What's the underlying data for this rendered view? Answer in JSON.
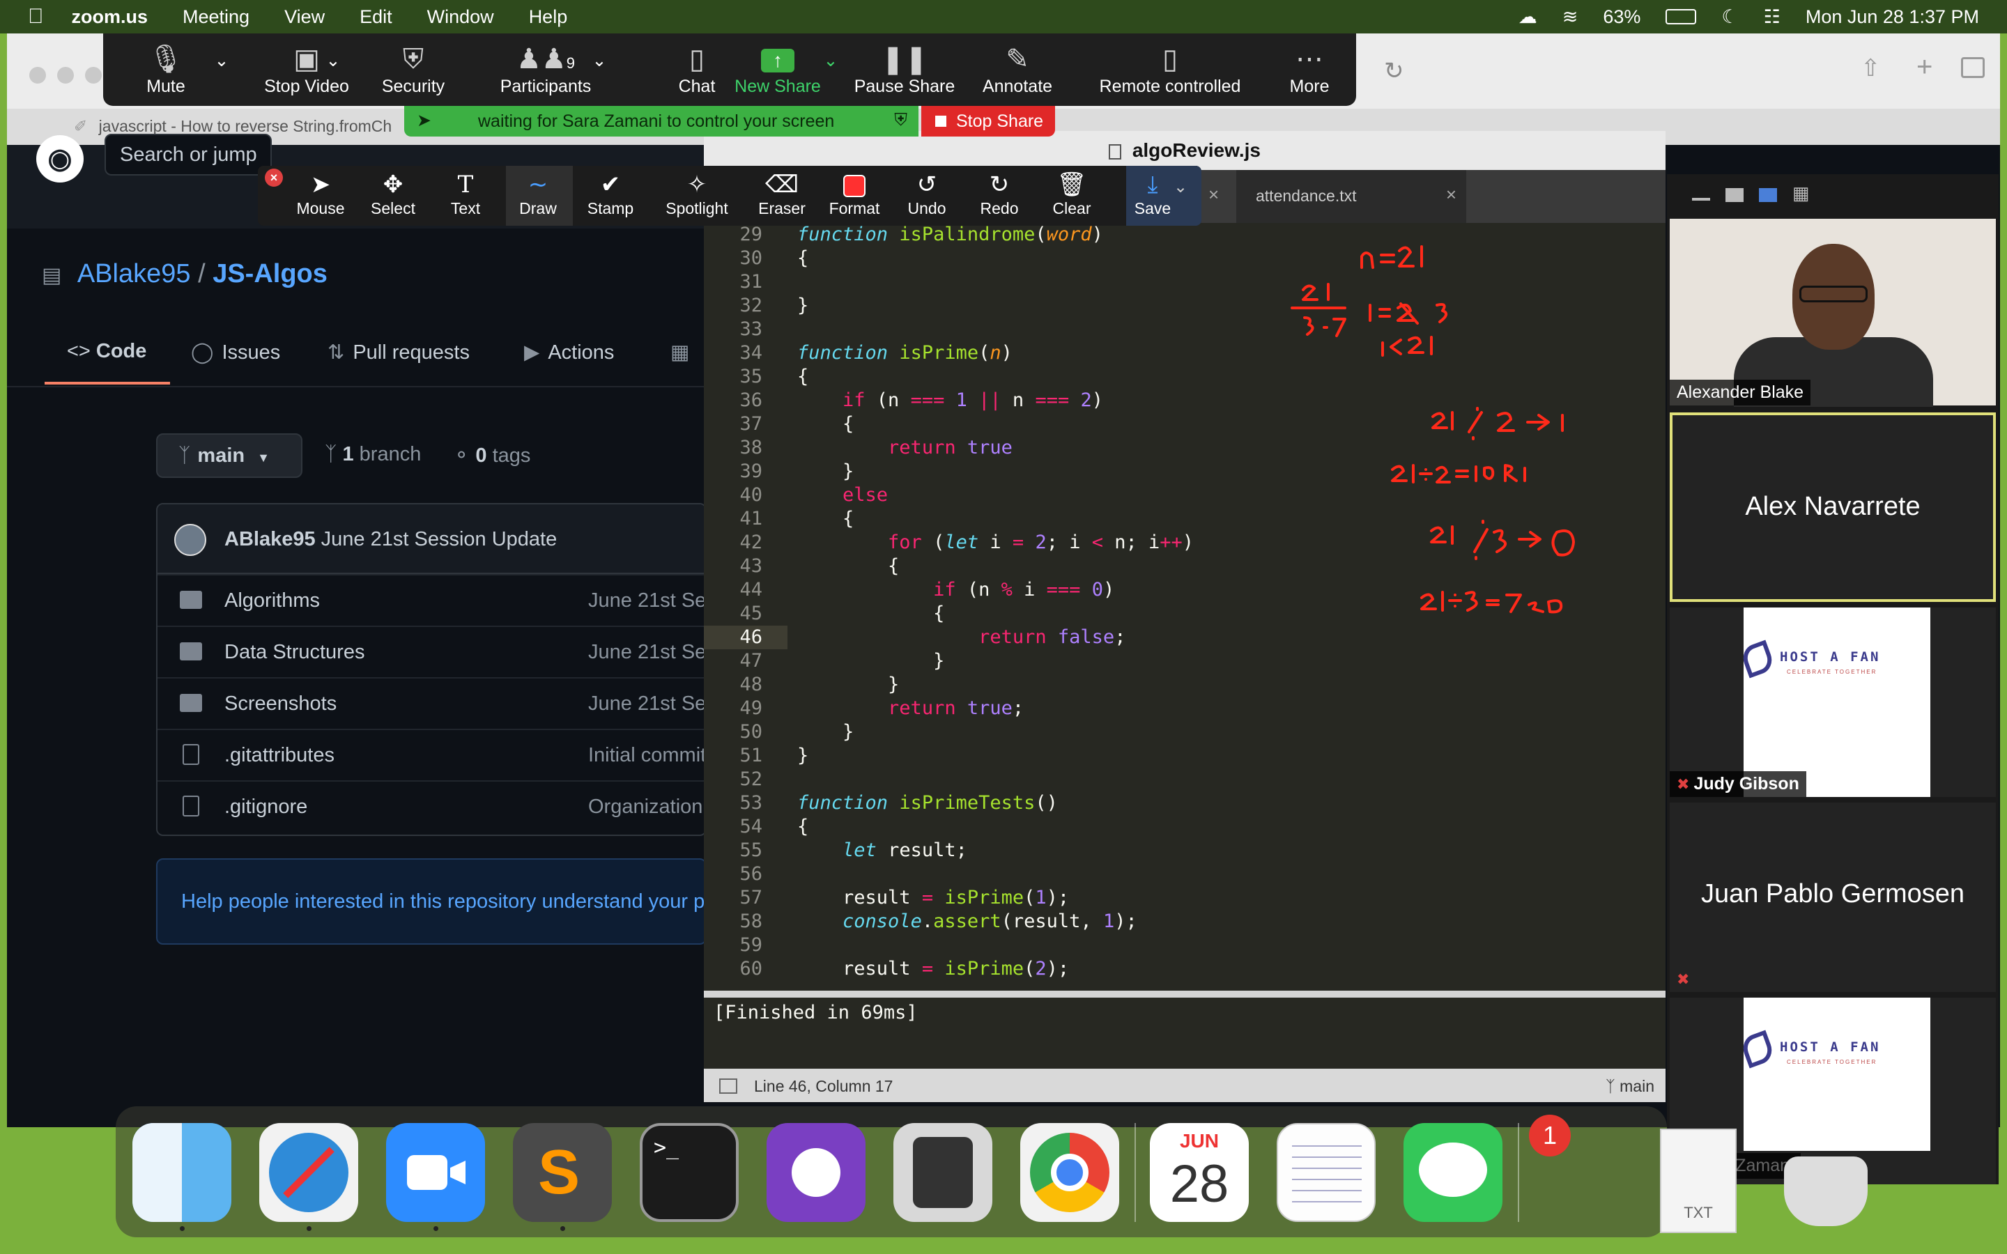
{
  "menubar": {
    "app": "zoom.us",
    "items": [
      "Meeting",
      "View",
      "Edit",
      "Window",
      "Help"
    ],
    "battery": "63%",
    "datetime": "Mon Jun 28  1:37 PM"
  },
  "browser": {
    "tab_title": "javascript - How to reverse String.fromCh",
    "search_placeholder": "Search or jump"
  },
  "github": {
    "owner": "ABlake95",
    "separator": "/",
    "repo": "JS-Algos",
    "tabs": [
      "Code",
      "Issues",
      "Pull requests",
      "Actions"
    ],
    "branch": "main",
    "branch_count": "1",
    "branch_label": "branch",
    "tag_count": "0",
    "tag_label": "tags",
    "commit_author": "ABlake95",
    "commit_message": "June 21st Session Update",
    "files": [
      {
        "name": "Algorithms",
        "type": "folder",
        "commit": "June 21st Se"
      },
      {
        "name": "Data Structures",
        "type": "folder",
        "commit": "June 21st Se"
      },
      {
        "name": "Screenshots",
        "type": "folder",
        "commit": "June 21st Se"
      },
      {
        "name": ".gitattributes",
        "type": "file",
        "commit": "Initial commit"
      },
      {
        "name": ".gitignore",
        "type": "file",
        "commit": "Organization"
      }
    ],
    "help_text": "Help people interested in this repository understand your p"
  },
  "zoom_toolbar": {
    "buttons": [
      {
        "label": "Mute",
        "icon": "microphone-icon"
      },
      {
        "label": "Stop Video",
        "icon": "video-camera-icon"
      },
      {
        "label": "Security",
        "icon": "shield-icon"
      },
      {
        "label": "Participants",
        "icon": "people-icon",
        "count": "9"
      },
      {
        "label": "Chat",
        "icon": "chat-bubble-icon"
      },
      {
        "label": "New Share",
        "icon": "share-screen-icon"
      },
      {
        "label": "Pause Share",
        "icon": "pause-icon"
      },
      {
        "label": "Annotate",
        "icon": "pen-icon"
      },
      {
        "label": "Remote controlled",
        "icon": "mouse-icon"
      },
      {
        "label": "More",
        "icon": "ellipsis-icon"
      }
    ],
    "status": "waiting for Sara Zamani to control your screen",
    "stop_share": "Stop Share"
  },
  "annotate_toolbar": {
    "tools": [
      "Mouse",
      "Select",
      "Text",
      "Draw",
      "Stamp",
      "Spotlight",
      "Eraser",
      "Format",
      "Undo",
      "Redo",
      "Clear",
      "Save"
    ],
    "active": "Draw",
    "format_color": "#ff3030"
  },
  "editor": {
    "window_title": "algoReview.js",
    "tab2": "attendance.txt",
    "first_line": 29,
    "current_line": "46",
    "console_output": "[Finished in 69ms]",
    "status": "Line 46, Column 17",
    "git_branch": "main"
  },
  "annotations": {
    "ink_color": "#ff2a1a",
    "notes": [
      "n=21",
      "i=2 3",
      "i<21",
      "21",
      "3·7",
      "21 % 2 → 1",
      "21÷2=10 R1",
      "21 % 3 → 0",
      "21÷3=7 R0"
    ]
  },
  "gallery": {
    "participants": [
      {
        "name": "Alexander Blake",
        "type": "video"
      },
      {
        "name": "Alex Navarrete",
        "type": "name"
      },
      {
        "name": "Judy Gibson",
        "type": "image",
        "muted": true
      },
      {
        "name": "Juan Pablo Germosen",
        "type": "name",
        "muted": true
      },
      {
        "name": "Sara Zamani",
        "type": "image",
        "muted": true
      }
    ],
    "hostfan_text": "HOST A FAN",
    "hostfan_sub": "CELEBRATE TOGETHER"
  },
  "dock": {
    "apps": [
      "Finder",
      "Safari",
      "Zoom",
      "Sublime Text",
      "Terminal",
      "GitHub Desktop",
      "Calculator",
      "Chrome",
      "Calendar",
      "TextEdit",
      "Messages"
    ],
    "calendar_month": "JUN",
    "calendar_day": "28",
    "messages_badge": "1",
    "file_label": "TXT"
  }
}
